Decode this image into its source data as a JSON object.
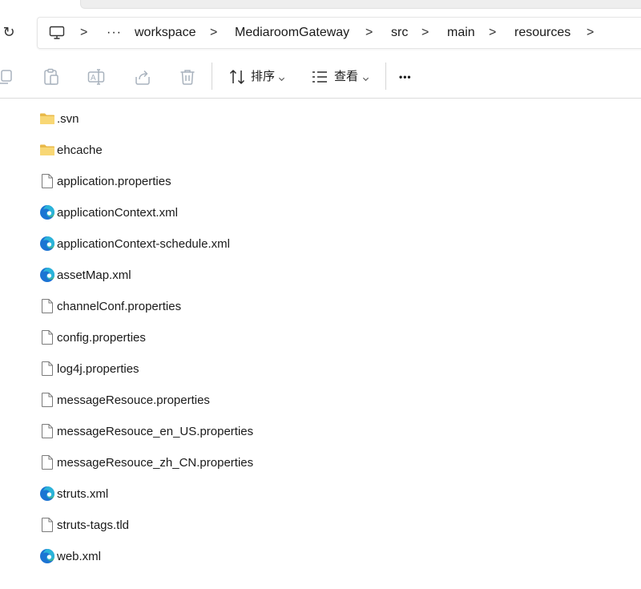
{
  "breadcrumb": {
    "items": [
      "workspace",
      "MediaroomGateway",
      "src",
      "main",
      "resources"
    ],
    "overflow": "···",
    "root_icon": "monitor-icon",
    "separator": ">"
  },
  "nav": {
    "refresh_icon": "refresh-icon",
    "refresh_glyph": "↻"
  },
  "toolbar": {
    "sort_label": "排序",
    "view_label": "查看",
    "more_glyph": "•••",
    "icons": [
      "copy-icon",
      "paste-icon",
      "rename-icon",
      "share-icon",
      "delete-icon",
      "sort-icon",
      "view-icon",
      "more-icon"
    ]
  },
  "files": [
    {
      "name": ".svn",
      "type": "folder"
    },
    {
      "name": "ehcache",
      "type": "folder"
    },
    {
      "name": "application.properties",
      "type": "file"
    },
    {
      "name": "applicationContext.xml",
      "type": "edge"
    },
    {
      "name": "applicationContext-schedule.xml",
      "type": "edge"
    },
    {
      "name": "assetMap.xml",
      "type": "edge"
    },
    {
      "name": "channelConf.properties",
      "type": "file"
    },
    {
      "name": "config.properties",
      "type": "file"
    },
    {
      "name": "log4j.properties",
      "type": "file"
    },
    {
      "name": "messageResouce.properties",
      "type": "file"
    },
    {
      "name": "messageResouce_en_US.properties",
      "type": "file"
    },
    {
      "name": "messageResouce_zh_CN.properties",
      "type": "file"
    },
    {
      "name": "struts.xml",
      "type": "edge"
    },
    {
      "name": "struts-tags.tld",
      "type": "file"
    },
    {
      "name": "web.xml",
      "type": "edge"
    }
  ],
  "colors": {
    "folder": "#f8d775",
    "folder_dark": "#e9b949",
    "edge_blue": "#1b74d3",
    "edge_green": "#4cc36a",
    "edge_teal": "#2bb4d9",
    "toolbar_disabled": "#a8b2bd"
  }
}
